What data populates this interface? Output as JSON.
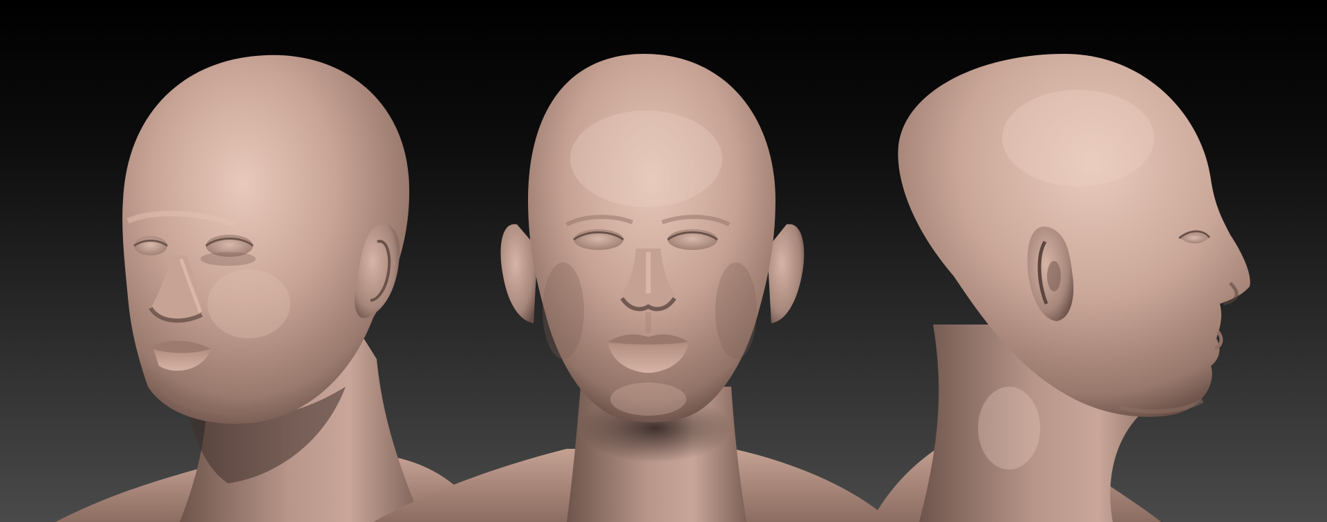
{
  "scene": {
    "background_top": "#000000",
    "background_bottom": "#4a4a4a",
    "clay_light": "#e2c2b4",
    "clay_mid": "#bd998b",
    "clay_dark": "#7a5e54",
    "clay_shadow": "#3e2e2a"
  },
  "views": [
    {
      "name": "three-quarter-view"
    },
    {
      "name": "front-view"
    },
    {
      "name": "profile-view"
    }
  ]
}
